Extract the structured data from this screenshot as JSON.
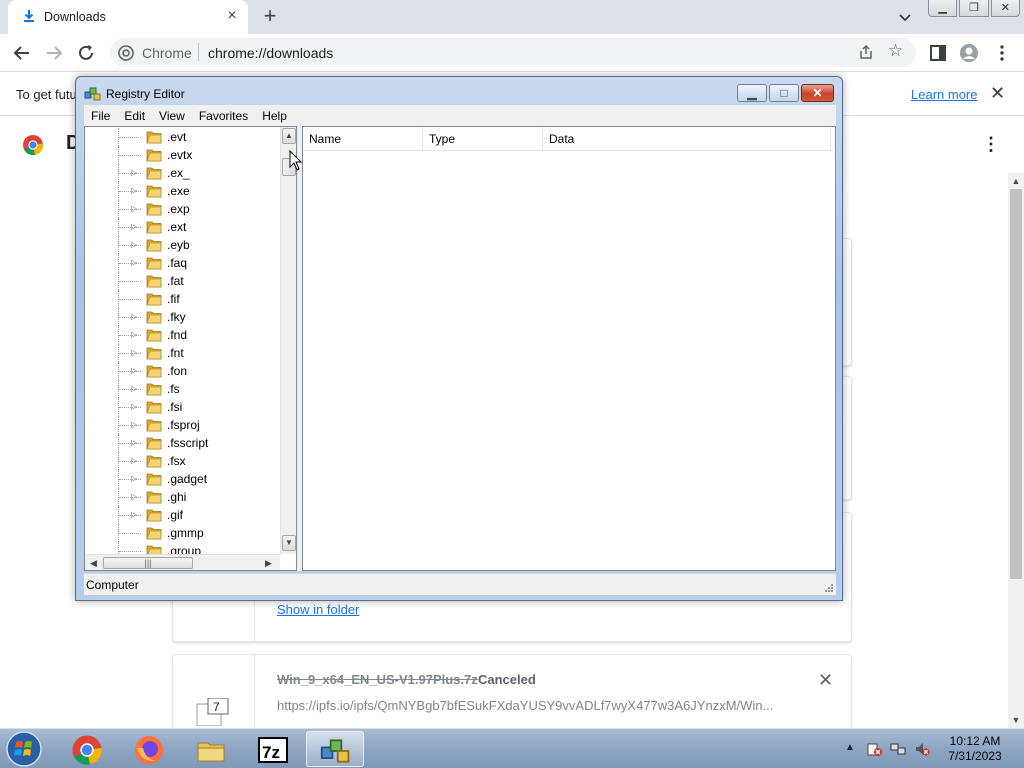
{
  "browser": {
    "tab_title": "Downloads",
    "omnibox_scheme": "Chrome",
    "omnibox_url": "chrome://downloads"
  },
  "infobar": {
    "text": "To get futu",
    "learn_more": "Learn more"
  },
  "downloads_page": {
    "title_fragment": "D",
    "show_in_folder": "Show in folder",
    "item": {
      "file_name": "Win_9_x64_EN_US-V1.97Plus.7z",
      "status": "Canceled",
      "url": "https://ipfs.io/ipfs/QmNYBgb7bfESukFXdaYUSY9vvADLf7wyX477w3A6JYnzxM/Win..."
    }
  },
  "regedit": {
    "title": "Registry Editor",
    "menu": [
      "File",
      "Edit",
      "View",
      "Favorites",
      "Help"
    ],
    "tree_items": [
      {
        "label": ".evt",
        "expandable": false
      },
      {
        "label": ".evtx",
        "expandable": false
      },
      {
        "label": ".ex_",
        "expandable": true
      },
      {
        "label": ".exe",
        "expandable": true
      },
      {
        "label": ".exp",
        "expandable": true
      },
      {
        "label": ".ext",
        "expandable": true
      },
      {
        "label": ".eyb",
        "expandable": true
      },
      {
        "label": ".faq",
        "expandable": true
      },
      {
        "label": ".fat",
        "expandable": false
      },
      {
        "label": ".fif",
        "expandable": false
      },
      {
        "label": ".fky",
        "expandable": true
      },
      {
        "label": ".fnd",
        "expandable": true
      },
      {
        "label": ".fnt",
        "expandable": true
      },
      {
        "label": ".fon",
        "expandable": true
      },
      {
        "label": ".fs",
        "expandable": true
      },
      {
        "label": ".fsi",
        "expandable": true
      },
      {
        "label": ".fsproj",
        "expandable": true
      },
      {
        "label": ".fsscript",
        "expandable": true
      },
      {
        "label": ".fsx",
        "expandable": true
      },
      {
        "label": ".gadget",
        "expandable": true
      },
      {
        "label": ".ghi",
        "expandable": true
      },
      {
        "label": ".gif",
        "expandable": true
      },
      {
        "label": ".gmmp",
        "expandable": false
      },
      {
        "label": ".group",
        "expandable": false
      }
    ],
    "columns": [
      "Name",
      "Type",
      "Data"
    ],
    "status": "Computer"
  },
  "taskbar": {
    "clock_time": "10:12 AM",
    "clock_date": "7/31/2023",
    "apps": [
      "chrome-icon",
      "firefox-icon",
      "file-explorer-icon",
      "7zip-icon",
      "regedit-icon"
    ]
  },
  "colors": {
    "chrome_link": "#1a73e8",
    "regedit_title_gradient": "#a9c3e3",
    "taskbar": "#8ea6c2"
  }
}
